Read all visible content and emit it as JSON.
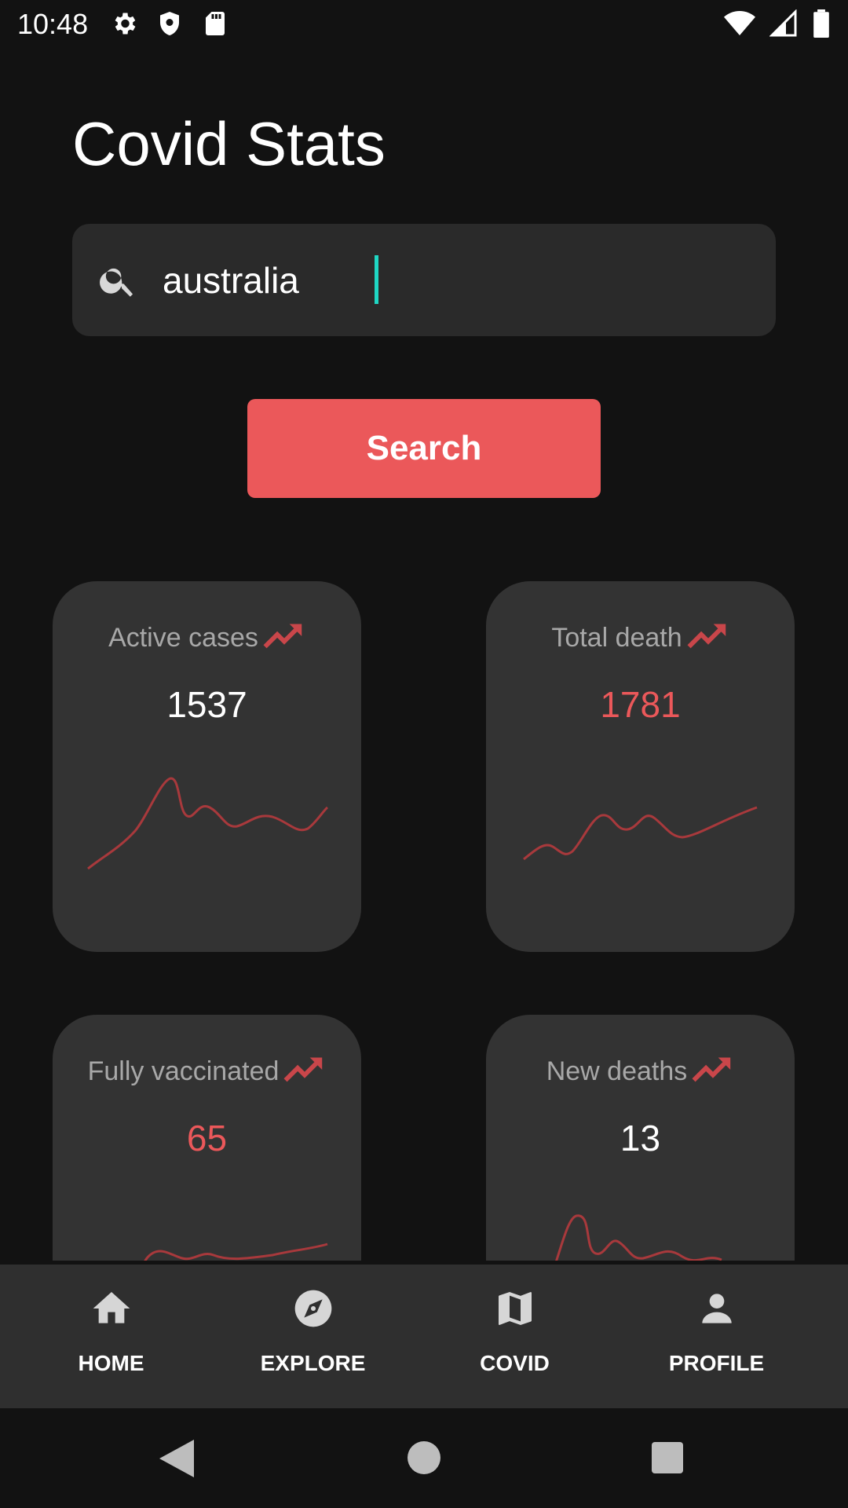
{
  "status": {
    "time": "10:48"
  },
  "title": "Covid Stats",
  "search": {
    "value": "australia",
    "placeholder": ""
  },
  "search_button": "Search",
  "accent": "#eb585a",
  "cards": [
    {
      "label": "Active cases",
      "value": "1537",
      "value_color": "#ffffff"
    },
    {
      "label": "Total death",
      "value": "1781",
      "value_color": "#eb585a"
    },
    {
      "label": "Fully vaccinated",
      "value": "65",
      "value_color": "#eb585a"
    },
    {
      "label": "New deaths",
      "value": "13",
      "value_color": "#ffffff"
    }
  ],
  "nav": [
    {
      "label": "HOME",
      "icon": "home-icon"
    },
    {
      "label": "EXPLORE",
      "icon": "compass-icon"
    },
    {
      "label": "COVID",
      "icon": "map-icon"
    },
    {
      "label": "PROFILE",
      "icon": "person-icon"
    }
  ]
}
